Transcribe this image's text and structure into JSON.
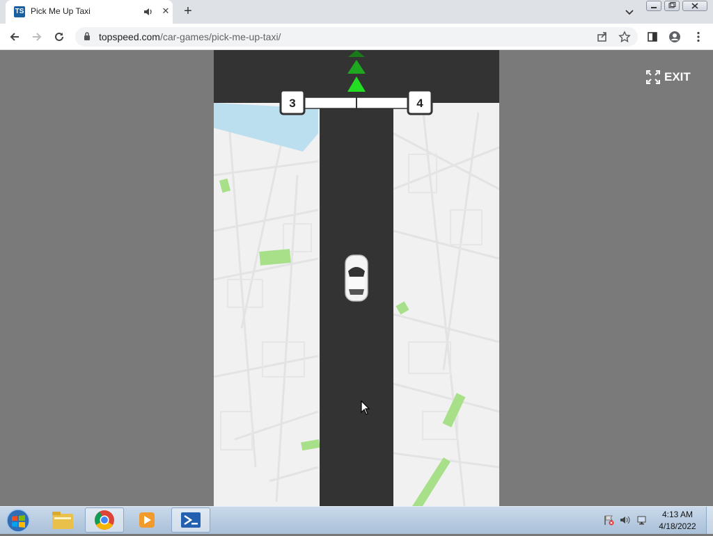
{
  "browser": {
    "tab_title": "Pick Me Up Taxi",
    "tab_favicon_text": "TS",
    "url_domain": "topspeed.com",
    "url_path": "/car-games/pick-me-up-taxi/"
  },
  "game": {
    "exit_label": "EXIT",
    "lane_left_number": "3",
    "lane_right_number": "4",
    "colors": {
      "road": "#333333",
      "map": "#f1f1f1",
      "arrow": "#22cc22",
      "water": "#bcdff0",
      "park": "#a8e08a",
      "overlay": "#7a7a7a"
    }
  },
  "taskbar": {
    "time": "4:13 AM",
    "date": "4/18/2022",
    "apps": [
      "windows-explorer",
      "chrome",
      "media-player",
      "powershell"
    ]
  }
}
